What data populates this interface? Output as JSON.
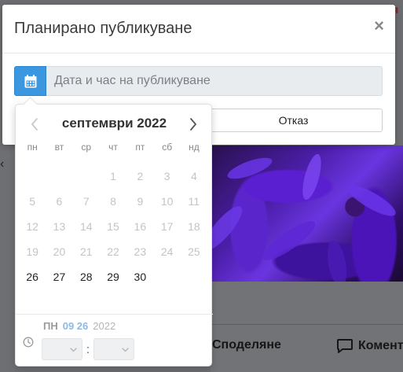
{
  "background": {
    "top_right_text": "я",
    "actions": {
      "share_label": "Споделяне",
      "comment_label": "Коментар"
    }
  },
  "modal": {
    "title": "Планирано публикуване",
    "close_label": "×",
    "date_input": {
      "value": "",
      "placeholder": "Дата и час на публикуване"
    },
    "cancel_label": "Отказ"
  },
  "datepicker": {
    "month_label": "септември 2022",
    "weekdays": [
      "пн",
      "вт",
      "ср",
      "чт",
      "пт",
      "сб",
      "нд"
    ],
    "weeks": [
      [
        "",
        "",
        "",
        "1",
        "2",
        "3",
        "4"
      ],
      [
        "5",
        "6",
        "7",
        "8",
        "9",
        "10",
        "11"
      ],
      [
        "12",
        "13",
        "14",
        "15",
        "16",
        "17",
        "18"
      ],
      [
        "19",
        "20",
        "21",
        "22",
        "23",
        "24",
        "25"
      ],
      [
        "26",
        "27",
        "28",
        "29",
        "30",
        "",
        ""
      ]
    ],
    "enabled_days": [
      "26",
      "27",
      "28",
      "29",
      "30"
    ],
    "selected": {
      "weekday": "ПН",
      "month_day": "09 26",
      "year": "2022"
    },
    "time": {
      "hour": "",
      "minute": "",
      "separator": ":"
    }
  },
  "colors": {
    "accent": "#3b97e0",
    "enabled_day": "#222222",
    "disabled_day": "#c4c4c4",
    "selected_month_day": "#8fb9e3"
  },
  "icons": {
    "calendar_button": "calendar-icon",
    "prev_month": "chevron-left-icon",
    "next_month": "chevron-right-icon",
    "time": "clock-icon",
    "close": "close-icon",
    "comment": "comment-icon"
  }
}
